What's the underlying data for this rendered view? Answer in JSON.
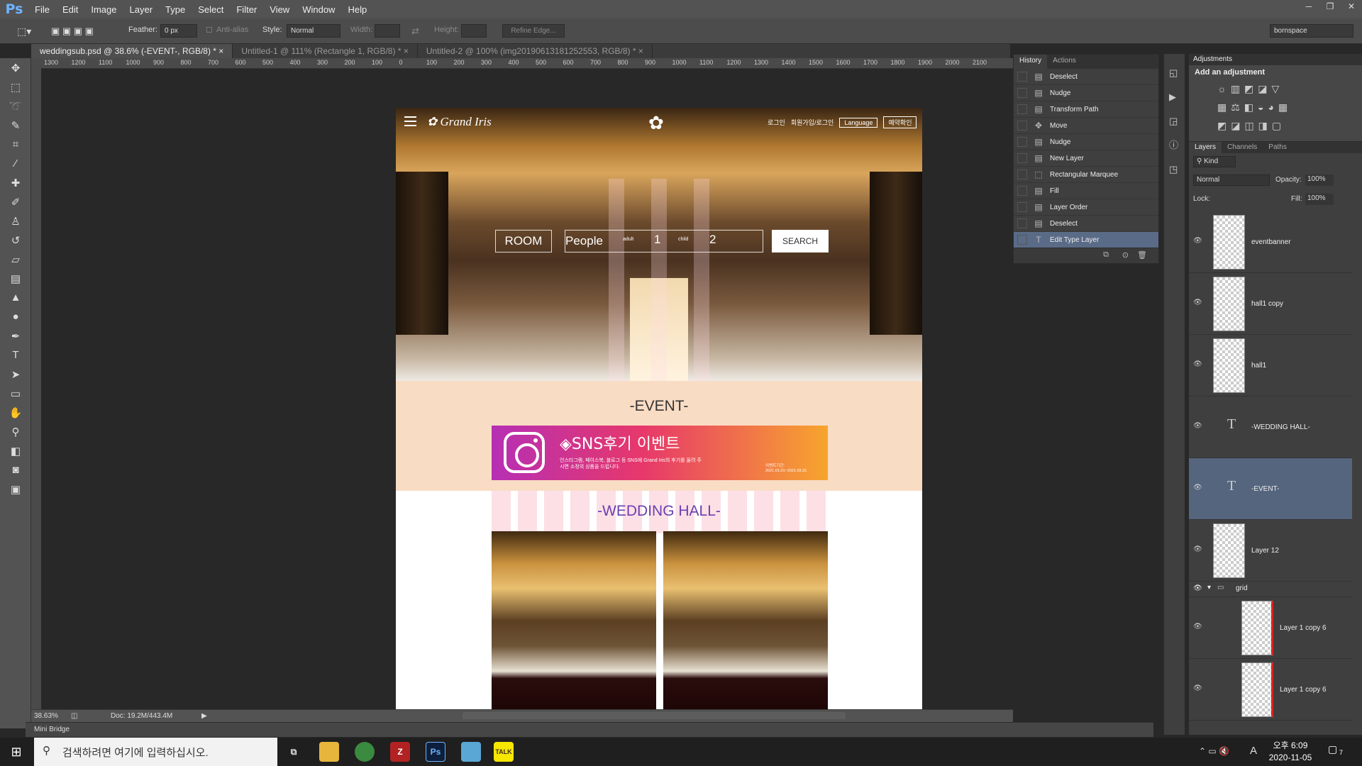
{
  "app": {
    "logo": "Ps"
  },
  "menu": [
    "File",
    "Edit",
    "Image",
    "Layer",
    "Type",
    "Select",
    "Filter",
    "View",
    "Window",
    "Help"
  ],
  "window_controls": {
    "minimize": "─",
    "restore": "❐",
    "close": "✕"
  },
  "options": {
    "feather_label": "Feather:",
    "feather_value": "0 px",
    "antialias_label": "Anti-alias",
    "style_label": "Style:",
    "style_value": "Normal",
    "width_label": "Width:",
    "height_label": "Height:",
    "refine_edge": "Refine Edge...",
    "workspace": "bornspace"
  },
  "tabs": [
    {
      "label": "weddingsub.psd @ 38.6% (-EVENT-, RGB/8) *",
      "close": "×"
    },
    {
      "label": "Untitled-1 @ 111% (Rectangle 1, RGB/8) *",
      "close": "×"
    },
    {
      "label": "Untitled-2 @ 100% (img20190613181252553, RGB/8) *",
      "close": "×"
    }
  ],
  "ruler_h": [
    "1300",
    "1200",
    "1100",
    "1000",
    "900",
    "800",
    "700",
    "600",
    "500",
    "400",
    "300",
    "200",
    "100",
    "0",
    "100",
    "200",
    "300",
    "400",
    "500",
    "600",
    "700",
    "800",
    "900",
    "1000",
    "1100",
    "1200",
    "1300",
    "1400",
    "1500",
    "1600",
    "1700",
    "1800",
    "1900",
    "2000",
    "2100"
  ],
  "document": {
    "logo_text": "Grand Iris",
    "top_links": [
      "로그인",
      "회원가입/로그인",
      "Language",
      "예약확인"
    ],
    "search": {
      "room": "ROOM",
      "people": "People",
      "adult_label": "adult",
      "adult_value": "1",
      "child_label": "child",
      "child_value": "2",
      "button": "SEARCH"
    },
    "event_title": "-EVENT-",
    "banner": {
      "title": "◈SNS후기 이벤트",
      "desc": "인스타그램, 페이스북, 블로그 등 SNS에 Grand Iris의 후기를 올려 주시면 소정의 상품을 드립니다.",
      "date_label": "이벤트기간:",
      "date": "2021.01.01~2021.03.31"
    },
    "wedding_title": "-WEDDING HALL-"
  },
  "status": {
    "zoom": "38.63%",
    "doc": "Doc: 19.2M/443.4M"
  },
  "mini_bridge": "Mini Bridge",
  "history": {
    "tabs": [
      "History",
      "Actions"
    ],
    "items": [
      {
        "label": "Deselect",
        "icon": "▤"
      },
      {
        "label": "Nudge",
        "icon": "▤"
      },
      {
        "label": "Transform Path",
        "icon": "▤"
      },
      {
        "label": "Move",
        "icon": "✥"
      },
      {
        "label": "Nudge",
        "icon": "▤"
      },
      {
        "label": "New Layer",
        "icon": "▤"
      },
      {
        "label": "Rectangular Marquee",
        "icon": "⬚"
      },
      {
        "label": "Fill",
        "icon": "▤"
      },
      {
        "label": "Layer Order",
        "icon": "▤"
      },
      {
        "label": "Deselect",
        "icon": "▤"
      },
      {
        "label": "Edit Type Layer",
        "icon": "T"
      }
    ]
  },
  "adjustments": {
    "tab": "Adjustments",
    "label": "Add an adjustment"
  },
  "layers_panel": {
    "tabs": [
      "Layers",
      "Channels",
      "Paths"
    ],
    "kind": "Kind",
    "blend": "Normal",
    "opacity_label": "Opacity:",
    "opacity": "100%",
    "lock_label": "Lock:",
    "fill_label": "Fill:",
    "fill": "100%",
    "layers": [
      {
        "name": "eventbanner",
        "type": "image"
      },
      {
        "name": "hall1 copy",
        "type": "image"
      },
      {
        "name": "hall1",
        "type": "image"
      },
      {
        "name": "-WEDDING HALL-",
        "type": "text"
      },
      {
        "name": "-EVENT-",
        "type": "text",
        "selected": true
      },
      {
        "name": "Layer 12",
        "type": "image"
      }
    ],
    "group": "grid",
    "group_layers": [
      "Layer 1 copy 6",
      "Layer 1 copy 6"
    ]
  },
  "taskbar": {
    "search_placeholder": "검색하려면 여기에 입력하십시오.",
    "apps": [
      "Files",
      "Chrome",
      "FileZilla",
      "Ps",
      "App",
      "TALK"
    ],
    "time": "오후 6:09",
    "date": "2020-11-05",
    "notification_count": "7",
    "ime": "A"
  },
  "colors": {
    "accent": "#5a6b87",
    "event_bg": "#f9dcc4",
    "wedding_title": "#6a3fb0"
  }
}
